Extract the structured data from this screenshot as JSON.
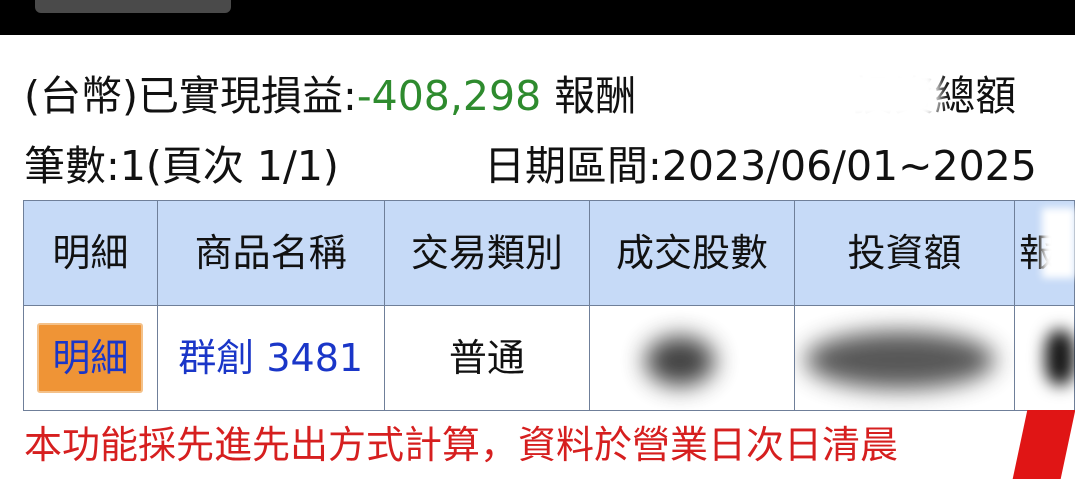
{
  "summary": {
    "pnl_label": "(台幣)已實現損益:",
    "pnl_value": "-408,298",
    "return_label": "報酬",
    "invest_total_label": "投資總額",
    "count_label": "筆數:1(頁次 1/1)",
    "period_label": "日期區間:",
    "period_value": "2023/06/01~2025"
  },
  "table": {
    "headers": [
      "明細",
      "商品名稱",
      "交易類別",
      "成交股數",
      "投資額",
      "報"
    ],
    "rows": [
      {
        "detail_button": "明細",
        "product": "群創 3481",
        "trade_type": "普通",
        "shares": "",
        "amount": "",
        "extra": ""
      }
    ]
  },
  "notice": "本功能採先進先出方式計算，資料於營業日次日清晨",
  "colors": {
    "pnl_negative": "#2e8b2e",
    "header_bg": "#c6daf7",
    "link": "#1a36c8",
    "button_bg": "#ef9436",
    "notice": "#d61f1f"
  }
}
